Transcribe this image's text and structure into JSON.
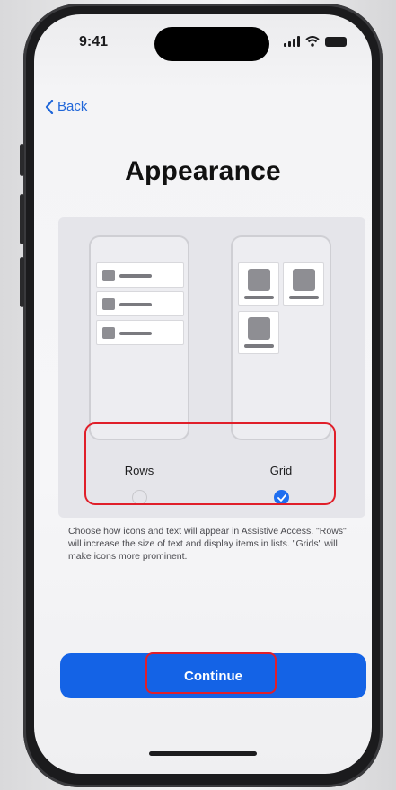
{
  "status_bar": {
    "time": "9:41"
  },
  "nav": {
    "back_label": "Back"
  },
  "page": {
    "title": "Appearance"
  },
  "options": [
    {
      "label": "Rows",
      "selected": false
    },
    {
      "label": "Grid",
      "selected": true
    }
  ],
  "description": "Choose how icons and text will appear in Assistive Access. \"Rows\" will increase the size of text and display items in lists. \"Grids\" will make icons more prominent.",
  "continue_label": "Continue",
  "colors": {
    "accent": "#1463e6",
    "highlight": "#e01f2a"
  },
  "icons": [
    "chevron-left-icon",
    "signal-icon",
    "wifi-icon",
    "battery-icon",
    "checkmark-icon"
  ]
}
